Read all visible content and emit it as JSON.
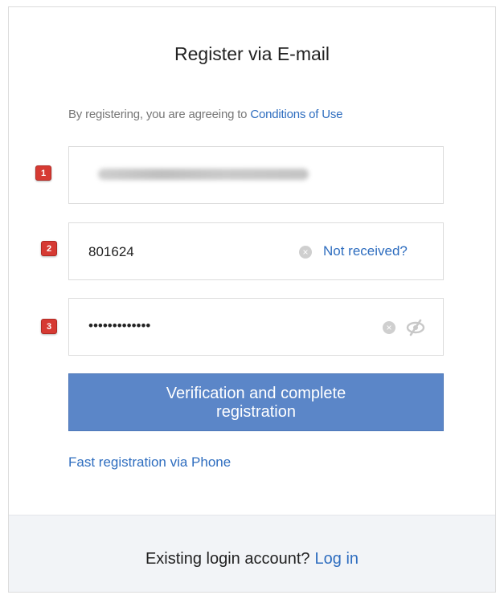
{
  "form": {
    "title": "Register via E-mail",
    "agreement_text": "By registering, you are agreeing to",
    "conditions_link": "Conditions of Use",
    "badges": [
      "1",
      "2",
      "3"
    ],
    "email_field": {
      "value": ""
    },
    "code_field": {
      "value": "801624",
      "not_received_link": "Not received?"
    },
    "password_field": {
      "value": "•••••••••••••"
    },
    "submit_line1": "Verification and complete",
    "submit_line2": "registration",
    "phone_link": "Fast registration via Phone"
  },
  "footer": {
    "question": "Existing login account?",
    "login_link": "Log in"
  },
  "colors": {
    "accent": "#2e6dbf",
    "button": "#5b86c8",
    "badge": "#d63a33",
    "footer_bg": "#f2f4f7"
  },
  "icons": [
    "clear-icon",
    "eye-slash-icon"
  ]
}
